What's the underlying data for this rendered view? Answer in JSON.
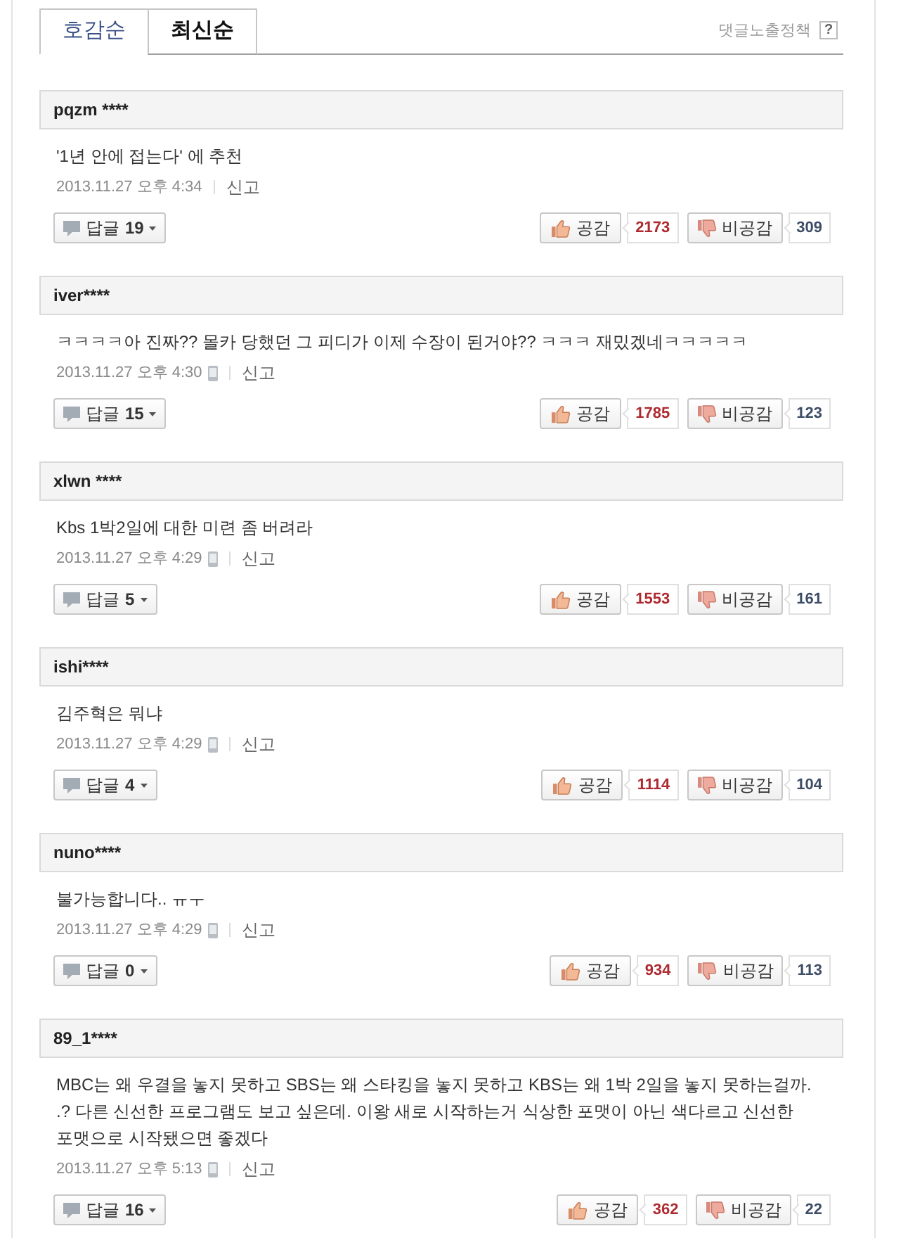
{
  "tabs": [
    {
      "label": "호감순",
      "selected": true
    },
    {
      "label": "최신순",
      "selected": false
    }
  ],
  "policy": {
    "label": "댓글노출정책",
    "help": "?"
  },
  "comments": [
    {
      "user": "pqzm ****",
      "text": "'1년 안에 접는다' 에 추천",
      "date": "2013.11.27 오후 4:34",
      "mobile": false,
      "report": "신고",
      "reply_label": "답글",
      "reply_count": "19",
      "like_label": "공감",
      "like_count": "2173",
      "dislike_label": "비공감",
      "dislike_count": "309"
    },
    {
      "user": "iver****",
      "text": "ㅋㅋㅋㅋ아 진짜?? 몰카 당했던 그 피디가 이제 수장이 된거야?? ㅋㅋㅋ 재밌겠네ㅋㅋㅋㅋㅋ",
      "date": "2013.11.27 오후 4:30",
      "mobile": true,
      "report": "신고",
      "reply_label": "답글",
      "reply_count": "15",
      "like_label": "공감",
      "like_count": "1785",
      "dislike_label": "비공감",
      "dislike_count": "123"
    },
    {
      "user": "xlwn ****",
      "text": "Kbs 1박2일에 대한 미련 좀 버려라",
      "date": "2013.11.27 오후 4:29",
      "mobile": true,
      "report": "신고",
      "reply_label": "답글",
      "reply_count": "5",
      "like_label": "공감",
      "like_count": "1553",
      "dislike_label": "비공감",
      "dislike_count": "161"
    },
    {
      "user": "ishi****",
      "text": "김주혁은 뭐냐",
      "date": "2013.11.27 오후 4:29",
      "mobile": true,
      "report": "신고",
      "reply_label": "답글",
      "reply_count": "4",
      "like_label": "공감",
      "like_count": "1114",
      "dislike_label": "비공감",
      "dislike_count": "104"
    },
    {
      "user": "nuno****",
      "text": "불가능합니다.. ㅠㅜ",
      "date": "2013.11.27 오후 4:29",
      "mobile": true,
      "report": "신고",
      "reply_label": "답글",
      "reply_count": "0",
      "like_label": "공감",
      "like_count": "934",
      "dislike_label": "비공감",
      "dislike_count": "113"
    },
    {
      "user": "89_1****",
      "text": "MBC는 왜 우결을 놓지 못하고 SBS는 왜 스타킹을 놓지 못하고 KBS는 왜 1박 2일을 놓지 못하는걸까. .? 다른 신선한 프로그램도 보고 싶은데. 이왕 새로 시작하는거 식상한 포맷이 아닌 색다르고 신선한 포맷으로 시작됐으면 좋겠다",
      "date": "2013.11.27 오후 5:13",
      "mobile": true,
      "report": "신고",
      "reply_label": "답글",
      "reply_count": "16",
      "like_label": "공감",
      "like_count": "362",
      "dislike_label": "비공감",
      "dislike_count": "22"
    }
  ]
}
